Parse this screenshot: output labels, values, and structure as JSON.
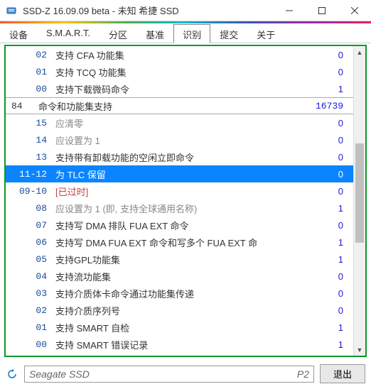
{
  "window": {
    "title": "SSD-Z 16.09.09 beta - 未知 希捷 SSD"
  },
  "tabs": {
    "items": [
      "设备",
      "S.M.A.R.T.",
      "分区",
      "基准",
      "识别",
      "提交",
      "关于"
    ],
    "active_index": 4
  },
  "list": {
    "header": {
      "code": "84",
      "desc": "命令和功能集支持",
      "val": "16739"
    },
    "rows_before": [
      {
        "code": "02",
        "desc": "支持 CFA 功能集",
        "val": "0",
        "style": "normal"
      },
      {
        "code": "01",
        "desc": "支持 TCQ 功能集",
        "val": "0",
        "style": "normal"
      },
      {
        "code": "00",
        "desc": "支持下载微码命令",
        "val": "1",
        "style": "normal"
      }
    ],
    "rows_after": [
      {
        "code": "15",
        "desc": "应清零",
        "val": "0",
        "style": "dim"
      },
      {
        "code": "14",
        "desc": "应设置为 1",
        "val": "0",
        "style": "dim"
      },
      {
        "code": "13",
        "desc": "支持带有卸载功能的空闲立即命令",
        "val": "0",
        "style": "normal"
      },
      {
        "code": "11-12",
        "desc": "为 TLC 保留",
        "val": "0",
        "style": "normal",
        "selected": true
      },
      {
        "code": "09-10",
        "desc": "[已过时]",
        "val": "0",
        "style": "obs"
      },
      {
        "code": "08",
        "desc": "应设置为 1 (即, 支持全球通用名称)",
        "val": "1",
        "style": "dim"
      },
      {
        "code": "07",
        "desc": "支持写 DMA 排队 FUA EXT 命令",
        "val": "0",
        "style": "normal"
      },
      {
        "code": "06",
        "desc": "支持写 DMA FUA EXT 命令和写多个 FUA EXT 命",
        "val": "1",
        "style": "normal"
      },
      {
        "code": "05",
        "desc": "支持GPL功能集",
        "val": "1",
        "style": "normal"
      },
      {
        "code": "04",
        "desc": "支持流功能集",
        "val": "0",
        "style": "normal"
      },
      {
        "code": "03",
        "desc": "支持介质体卡命令通过功能集传递",
        "val": "0",
        "style": "normal"
      },
      {
        "code": "02",
        "desc": "支持介质序列号",
        "val": "0",
        "style": "normal"
      },
      {
        "code": "01",
        "desc": "支持 SMART 自检",
        "val": "1",
        "style": "normal"
      },
      {
        "code": "00",
        "desc": "支持 SMART 错误记录",
        "val": "1",
        "style": "normal"
      }
    ]
  },
  "status": {
    "device": "Seagate SSD",
    "page": "P2",
    "exit": "退出"
  }
}
